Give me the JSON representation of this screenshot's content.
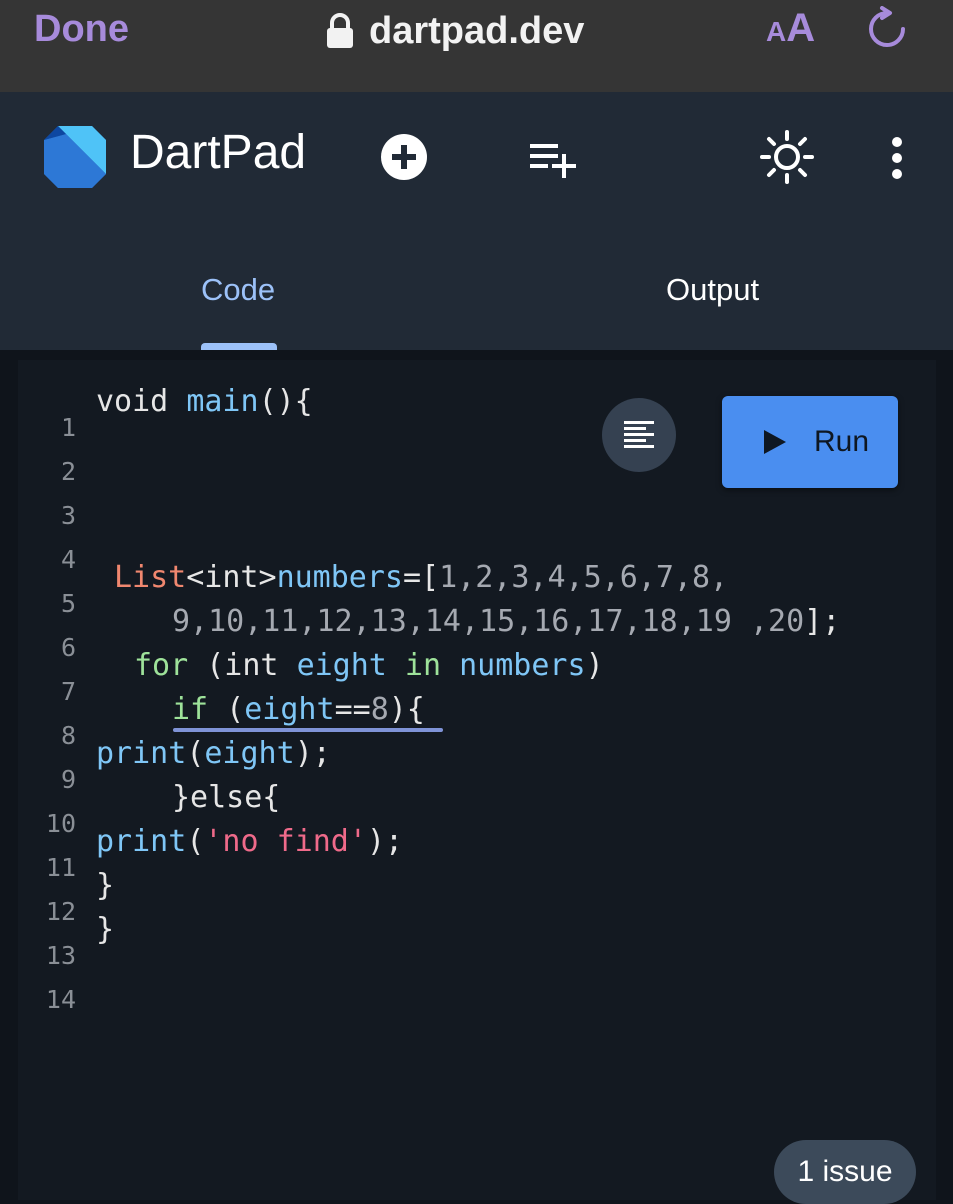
{
  "browser": {
    "done_label": "Done",
    "url": "dartpad.dev",
    "text_size_small": "A",
    "text_size_big": "A"
  },
  "header": {
    "title": "DartPad"
  },
  "tabs": [
    {
      "label": "Code",
      "active": true
    },
    {
      "label": "Output",
      "active": false
    }
  ],
  "editor": {
    "line_numbers": [
      "1",
      "2",
      "3",
      "4",
      "5",
      "6",
      "7",
      "8",
      "9",
      "10",
      "11",
      "12",
      "13",
      "14"
    ],
    "run_label": "Run",
    "issues_label": "1 issue",
    "code": {
      "l1_kw": "void",
      "l1_fn": "main",
      "l1_rest": "(){",
      "l5_type": "List",
      "l5_generic": "<int>",
      "l5_name": "numbers",
      "l5_eq": "=[",
      "l5_nums": "1,2,3,4,5,6,7,8,",
      "l6_nums": "9,10,11,12,13,14,15,16,17,18,19 ,20",
      "l6_end": "];",
      "l7_for": "for",
      "l7_open": " (int ",
      "l7_var": "eight",
      "l7_in": " in ",
      "l7_list": "numbers",
      "l7_close": ")",
      "l8_if": "if",
      "l8_open": " (",
      "l8_var": "eight",
      "l8_op": "==",
      "l8_num": "8",
      "l8_close": "){",
      "l9_fn": "print",
      "l9_open": "(",
      "l9_var": "eight",
      "l9_close": ");",
      "l10": "}else{",
      "l11_fn": "print",
      "l11_open": "(",
      "l11_str": "'no find'",
      "l11_close": ");",
      "l12": "}",
      "l13": "}"
    }
  },
  "colors": {
    "browser_accent": "#a78bdb",
    "tab_active": "#9cc1f8",
    "run_button": "#4a8ef0"
  },
  "icons": [
    "lock-icon",
    "reload-icon",
    "dart-logo",
    "add-circle-icon",
    "playlist-add-icon",
    "brightness-icon",
    "more-vert-icon",
    "format-align-icon",
    "play-icon"
  ]
}
